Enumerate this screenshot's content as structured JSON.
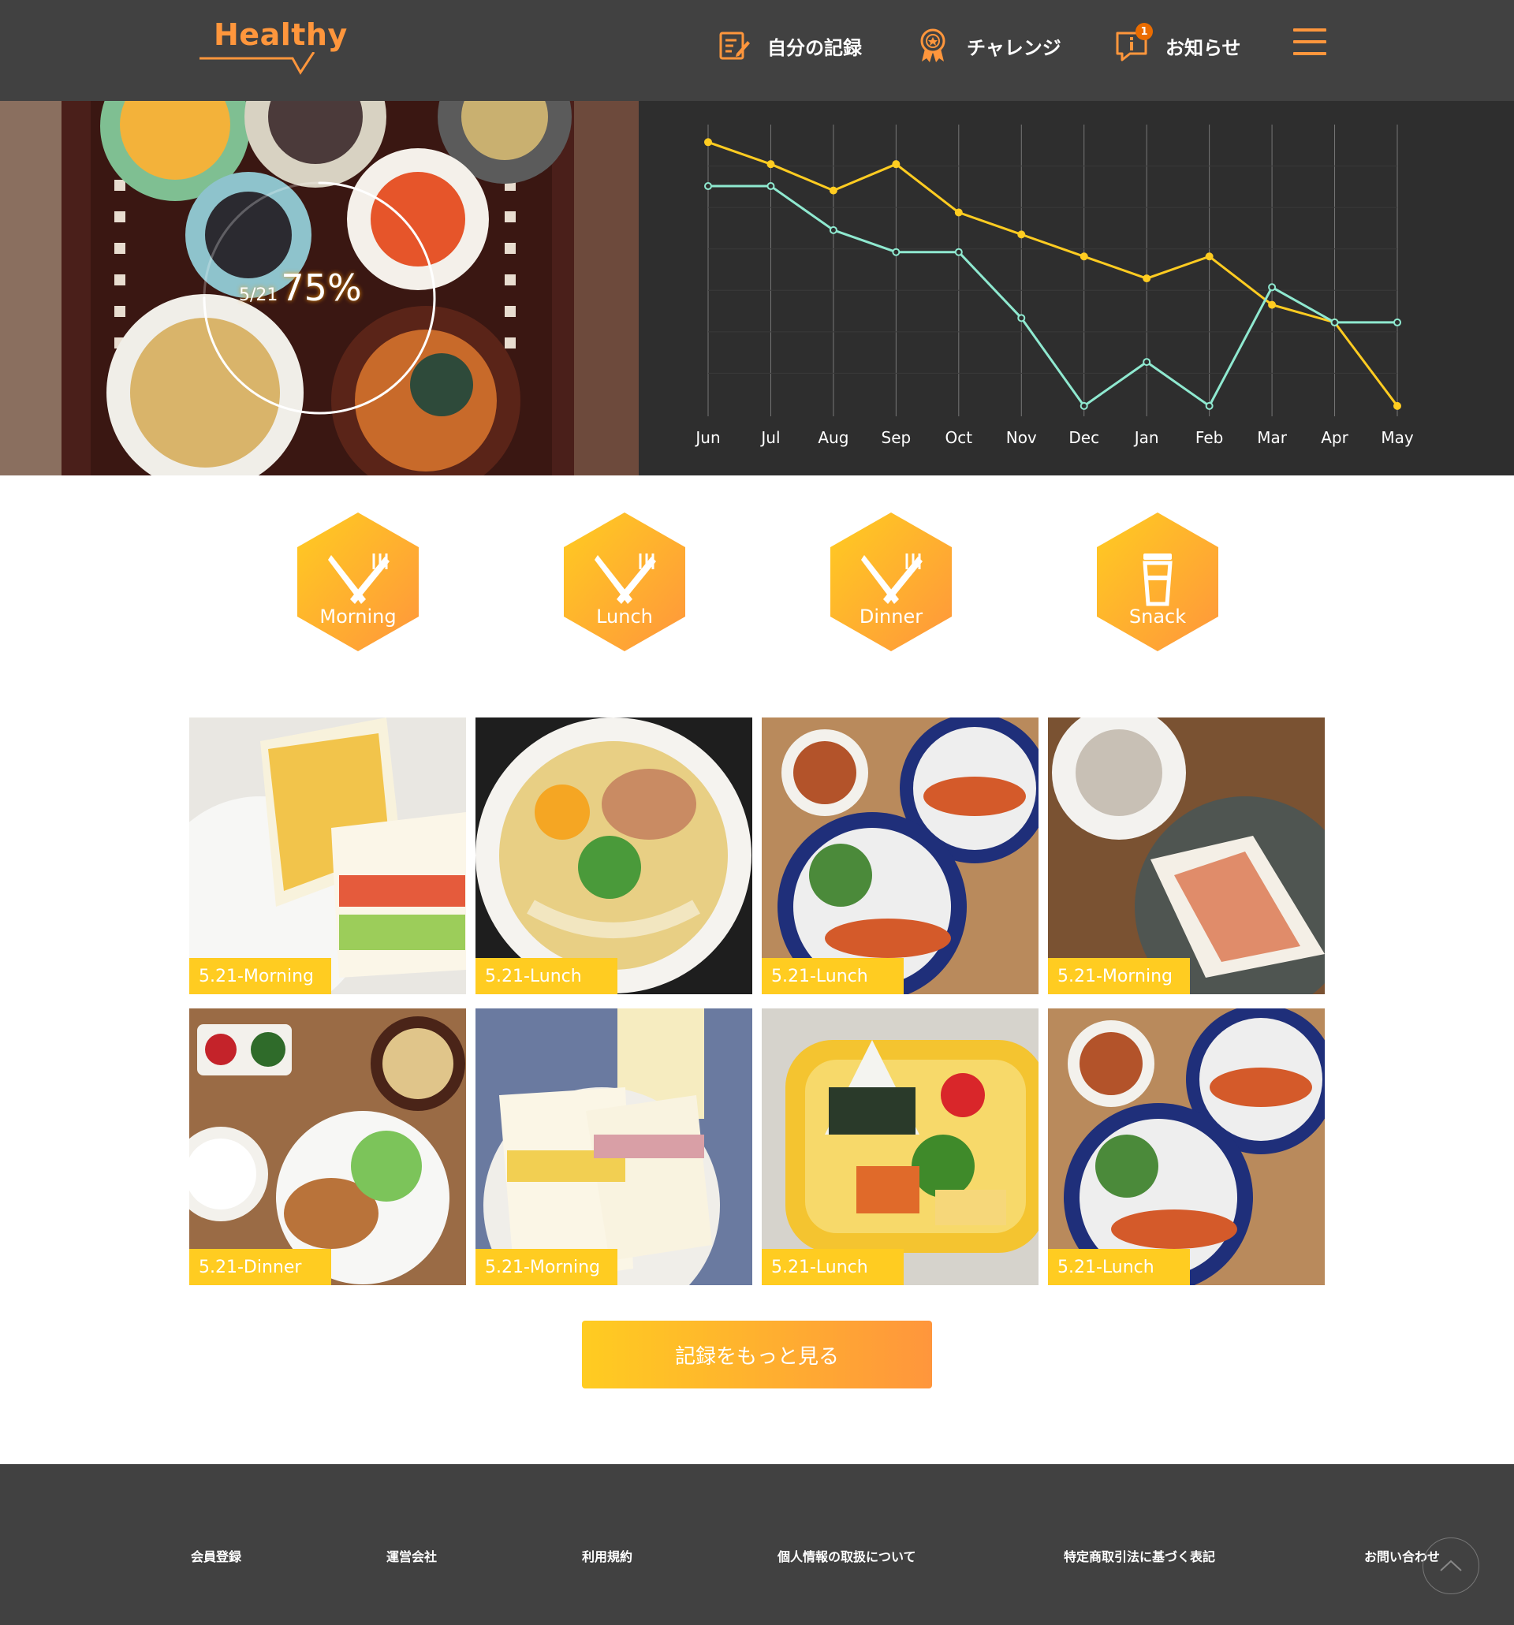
{
  "header": {
    "logo": "Healthy",
    "nav": [
      {
        "label": "自分の記録",
        "icon": "memo-icon"
      },
      {
        "label": "チャレンジ",
        "icon": "medal-icon"
      },
      {
        "label": "お知らせ",
        "icon": "info-icon",
        "badge": "1"
      }
    ],
    "menu_icon": "hamburger-menu-icon"
  },
  "hero": {
    "achievement": {
      "date": "5/21",
      "percent": "75%",
      "value": 0.75
    }
  },
  "chart_data": {
    "type": "line",
    "categories": [
      "Jun",
      "Jul",
      "Aug",
      "Sep",
      "Oct",
      "Nov",
      "Dec",
      "Jan",
      "Feb",
      "Mar",
      "Apr",
      "May"
    ],
    "series": [
      {
        "color": "#FFCC21",
        "values": [
          100,
          95,
          89,
          95,
          84,
          79,
          74,
          69,
          74,
          63,
          59,
          40
        ]
      },
      {
        "color": "#8FE9D0",
        "values": [
          90,
          90,
          80,
          75,
          75,
          60,
          40,
          50,
          40,
          67,
          59,
          59
        ]
      }
    ],
    "ylim": [
      38,
      104
    ],
    "grid": true,
    "title": "",
    "xlabel": "",
    "ylabel": ""
  },
  "categories": [
    {
      "label": "Morning",
      "icon": "knife-fork-icon"
    },
    {
      "label": "Lunch",
      "icon": "knife-fork-icon"
    },
    {
      "label": "Dinner",
      "icon": "knife-fork-icon"
    },
    {
      "label": "Snack",
      "icon": "cup-icon"
    }
  ],
  "meals": [
    {
      "label": "5.21-Morning"
    },
    {
      "label": "5.21-Lunch"
    },
    {
      "label": "5.21-Lunch"
    },
    {
      "label": "5.21-Morning"
    },
    {
      "label": "5.21-Dinner"
    },
    {
      "label": "5.21-Morning"
    },
    {
      "label": "5.21-Lunch"
    },
    {
      "label": "5.21-Lunch"
    }
  ],
  "more_button": "記録をもっと見る",
  "footer": {
    "links": [
      "会員登録",
      "運営会社",
      "利用規約",
      "個人情報の取扱について",
      "特定商取引法に基づく表記",
      "お問い合わせ"
    ]
  },
  "colors": {
    "primary": "#FFCC21",
    "accent": "#FF963C",
    "dark": "#414141",
    "chart_bg": "#2E2E2E",
    "secondary": "#8FE9D0"
  }
}
